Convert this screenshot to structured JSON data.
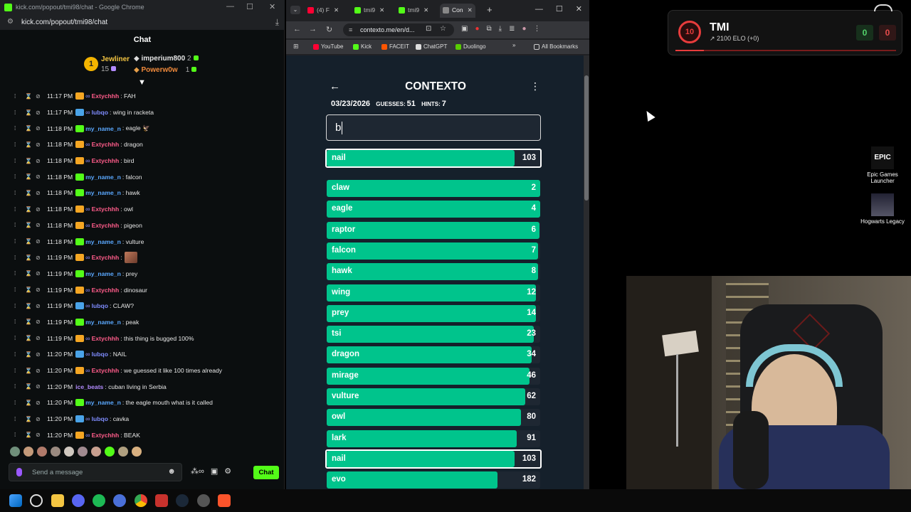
{
  "chat_window": {
    "title": "kick.com/popout/tmi98/chat - Google Chrome",
    "url": "kick.com/popout/tmi98/chat",
    "header": "Chat",
    "pinned": {
      "rank": "1",
      "top_gifter": "Jewliner",
      "top_gifter_count": "15",
      "users": [
        {
          "name": "imperium800",
          "count": "2"
        },
        {
          "name": "Powerw0w",
          "count": "1"
        }
      ]
    },
    "messages": [
      {
        "time": "11:17 PM",
        "badge": "crown",
        "user": "Extychhh",
        "cls": "nm-ext",
        "text": ": FAH"
      },
      {
        "time": "11:17 PM",
        "badge": "sword",
        "user": "lubqo",
        "cls": "nm-lub",
        "text": ": wing in racketa"
      },
      {
        "time": "11:18 PM",
        "badge": "sub",
        "user": "my_name_n",
        "cls": "nm-my",
        "text": ": eagle 🦅"
      },
      {
        "time": "11:18 PM",
        "badge": "crown",
        "user": "Extychhh",
        "cls": "nm-ext",
        "text": ": dragon"
      },
      {
        "time": "11:18 PM",
        "badge": "crown",
        "user": "Extychhh",
        "cls": "nm-ext",
        "text": ": bird"
      },
      {
        "time": "11:18 PM",
        "badge": "sub",
        "user": "my_name_n",
        "cls": "nm-my",
        "text": ": falcon"
      },
      {
        "time": "11:18 PM",
        "badge": "sub",
        "user": "my_name_n",
        "cls": "nm-my",
        "text": ": hawk"
      },
      {
        "time": "11:18 PM",
        "badge": "crown",
        "user": "Extychhh",
        "cls": "nm-ext",
        "text": ": owl"
      },
      {
        "time": "11:18 PM",
        "badge": "crown",
        "user": "Extychhh",
        "cls": "nm-ext",
        "text": ": pigeon"
      },
      {
        "time": "11:18 PM",
        "badge": "sub",
        "user": "my_name_n",
        "cls": "nm-my",
        "text": ": vulture"
      },
      {
        "time": "11:19 PM",
        "badge": "crown",
        "user": "Extychhh",
        "cls": "nm-ext",
        "text": ":",
        "emote": true
      },
      {
        "time": "11:19 PM",
        "badge": "sub",
        "user": "my_name_n",
        "cls": "nm-my",
        "text": ": prey"
      },
      {
        "time": "11:19 PM",
        "badge": "crown",
        "user": "Extychhh",
        "cls": "nm-ext",
        "text": ": dinosaur"
      },
      {
        "time": "11:19 PM",
        "badge": "sword",
        "user": "lubqo",
        "cls": "nm-lub",
        "text": ": CLAW?"
      },
      {
        "time": "11:19 PM",
        "badge": "sub",
        "user": "my_name_n",
        "cls": "nm-my",
        "text": ": peak"
      },
      {
        "time": "11:19 PM",
        "badge": "crown",
        "user": "Extychhh",
        "cls": "nm-ext",
        "text": ": this thing is bugged 100%"
      },
      {
        "time": "11:20 PM",
        "badge": "sword",
        "user": "lubqo",
        "cls": "nm-lub",
        "text": ": NAIL"
      },
      {
        "time": "11:20 PM",
        "badge": "crown",
        "user": "Extychhh",
        "cls": "nm-ext",
        "text": ": we guessed it like 100 times already"
      },
      {
        "time": "11:20 PM",
        "badge": "none",
        "user": "ice_beats",
        "cls": "nm-ice",
        "text": ": cuban living in Serbia"
      },
      {
        "time": "11:20 PM",
        "badge": "sub",
        "user": "my_name_n",
        "cls": "nm-my",
        "text": ": the eagle mouth what is it called"
      },
      {
        "time": "11:20 PM",
        "badge": "sword",
        "user": "lubqo",
        "cls": "nm-lub",
        "text": ": cavka"
      },
      {
        "time": "11:20 PM",
        "badge": "crown",
        "user": "Extychhh",
        "cls": "nm-ext",
        "text": ": BEAK"
      }
    ],
    "input_placeholder": "Send a message",
    "send_label": "Chat"
  },
  "browser": {
    "tabs": [
      {
        "label": "(4) F",
        "color": "#ff0033"
      },
      {
        "label": "tmi9",
        "color": "#53fc18"
      },
      {
        "label": "tmi9",
        "color": "#53fc18"
      },
      {
        "label": "Con",
        "color": "#888888",
        "active": true
      }
    ],
    "url": "contexto.me/en/d...",
    "bookmarks": [
      {
        "label": "YouTube",
        "color": "#ff0033"
      },
      {
        "label": "Kick",
        "color": "#53fc18"
      },
      {
        "label": "FACEIT",
        "color": "#ff5500"
      },
      {
        "label": "ChatGPT",
        "color": "#ffffff"
      },
      {
        "label": "Duolingo",
        "color": "#58cc02"
      }
    ],
    "bookmarks_more": "»",
    "all_bookmarks": "All Bookmarks"
  },
  "contexto": {
    "title": "CONTEXTO",
    "date": "03/23/2026",
    "guesses_label": "GUESSES:",
    "guesses": "51",
    "hints_label": "HINTS:",
    "hints": "7",
    "input_value": "b",
    "last_guess": {
      "word": "nail",
      "rank": 103,
      "fill": 0.88
    },
    "guesses_list": [
      {
        "word": "claw",
        "rank": 2,
        "fill": 1.0
      },
      {
        "word": "eagle",
        "rank": 4,
        "fill": 1.0
      },
      {
        "word": "raptor",
        "rank": 6,
        "fill": 0.995
      },
      {
        "word": "falcon",
        "rank": 7,
        "fill": 0.99
      },
      {
        "word": "hawk",
        "rank": 8,
        "fill": 0.99
      },
      {
        "word": "wing",
        "rank": 12,
        "fill": 0.98
      },
      {
        "word": "prey",
        "rank": 14,
        "fill": 0.98
      },
      {
        "word": "tsi",
        "rank": 23,
        "fill": 0.97
      },
      {
        "word": "dragon",
        "rank": 34,
        "fill": 0.96
      },
      {
        "word": "mirage",
        "rank": 46,
        "fill": 0.95
      },
      {
        "word": "vulture",
        "rank": 62,
        "fill": 0.93
      },
      {
        "word": "owl",
        "rank": 80,
        "fill": 0.91
      },
      {
        "word": "lark",
        "rank": 91,
        "fill": 0.89
      },
      {
        "word": "nail",
        "rank": 103,
        "fill": 0.88,
        "highlight": true
      },
      {
        "word": "evo",
        "rank": 182,
        "fill": 0.8
      }
    ]
  },
  "overlay": {
    "level": "10",
    "name": "TMI",
    "elo": "2100 ELO (+0)",
    "wins": "0",
    "losses": "0"
  },
  "desktop": {
    "icons": [
      {
        "label": "Epic Games Launcher",
        "logo": "EPIC"
      },
      {
        "label": "Hogwarts Legacy"
      }
    ]
  }
}
